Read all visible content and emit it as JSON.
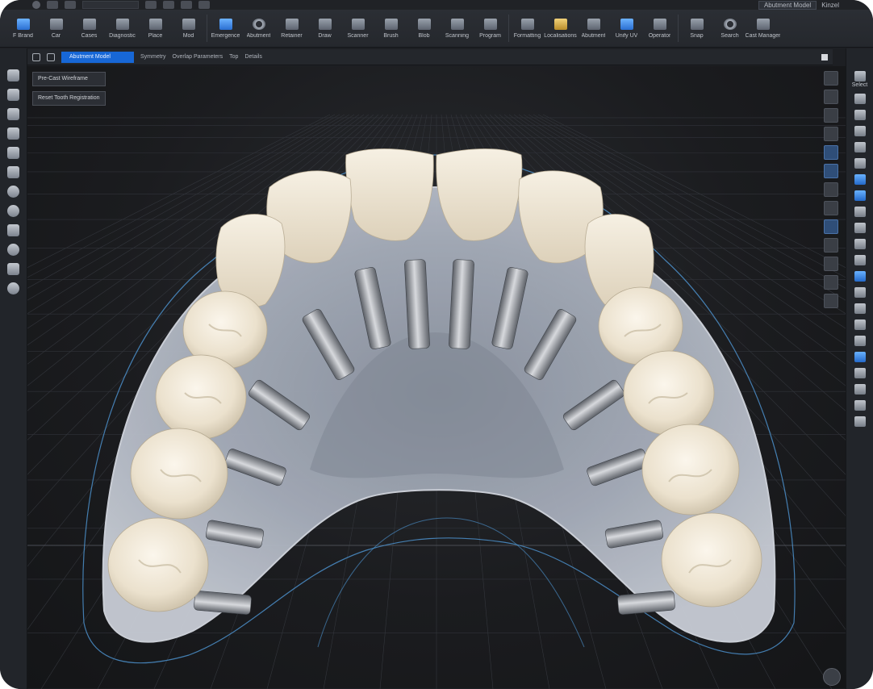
{
  "topbar": {
    "search_value": "",
    "doc_label": "Abutment Model",
    "user_label": "Kinzel"
  },
  "ribbon": {
    "tools": [
      {
        "label": "F Brand",
        "icon": "blue-cube-icon"
      },
      {
        "label": "Car",
        "icon": "tool-icon"
      },
      {
        "label": "Cases",
        "icon": "tool-icon"
      },
      {
        "label": "Diagnostic",
        "icon": "tool-icon"
      },
      {
        "label": "Place",
        "icon": "tool-icon"
      },
      {
        "label": "Mod",
        "icon": "tool-icon"
      },
      {
        "label": "Emergence",
        "icon": "blue-cube-icon"
      },
      {
        "label": "Abutment",
        "icon": "ring-icon"
      },
      {
        "label": "Retainer",
        "icon": "tool-icon"
      },
      {
        "label": "Draw",
        "icon": "tool-icon"
      },
      {
        "label": "Scanner",
        "icon": "tool-icon"
      },
      {
        "label": "Brush",
        "icon": "tool-icon"
      },
      {
        "label": "Blob",
        "icon": "tool-icon"
      },
      {
        "label": "Scanning",
        "icon": "tool-icon"
      },
      {
        "label": "Program",
        "icon": "tool-icon"
      },
      {
        "label": "Formatting",
        "icon": "tool-icon"
      },
      {
        "label": "Localisations",
        "icon": "gold-tool-icon"
      },
      {
        "label": "Abutment",
        "icon": "tool-icon"
      },
      {
        "label": "Unify UV",
        "icon": "blue-sphere-icon"
      },
      {
        "label": "Operator",
        "icon": "tool-icon"
      },
      {
        "label": "Snap",
        "icon": "tool-icon"
      },
      {
        "label": "Search",
        "icon": "ring-icon"
      },
      {
        "label": "Cast Manager",
        "icon": "tool-icon"
      }
    ]
  },
  "viewport_header": {
    "active_tab": "Abutment Model",
    "tabs": [
      "Symmetry",
      "Overlap Parameters",
      "Top",
      "Details"
    ]
  },
  "overlay": {
    "btn1": "Pre-Cast Wireframe",
    "btn2": "Reset Tooth Registration"
  },
  "rightpanel": {
    "title": "Select"
  },
  "colors": {
    "accent": "#1767d6",
    "background": "#1d1f23",
    "tooth": "#ebe2cf",
    "implant_metal": "#9a9ea5",
    "base_resin": "#b9bfca",
    "outline": "#5aa6e8"
  }
}
